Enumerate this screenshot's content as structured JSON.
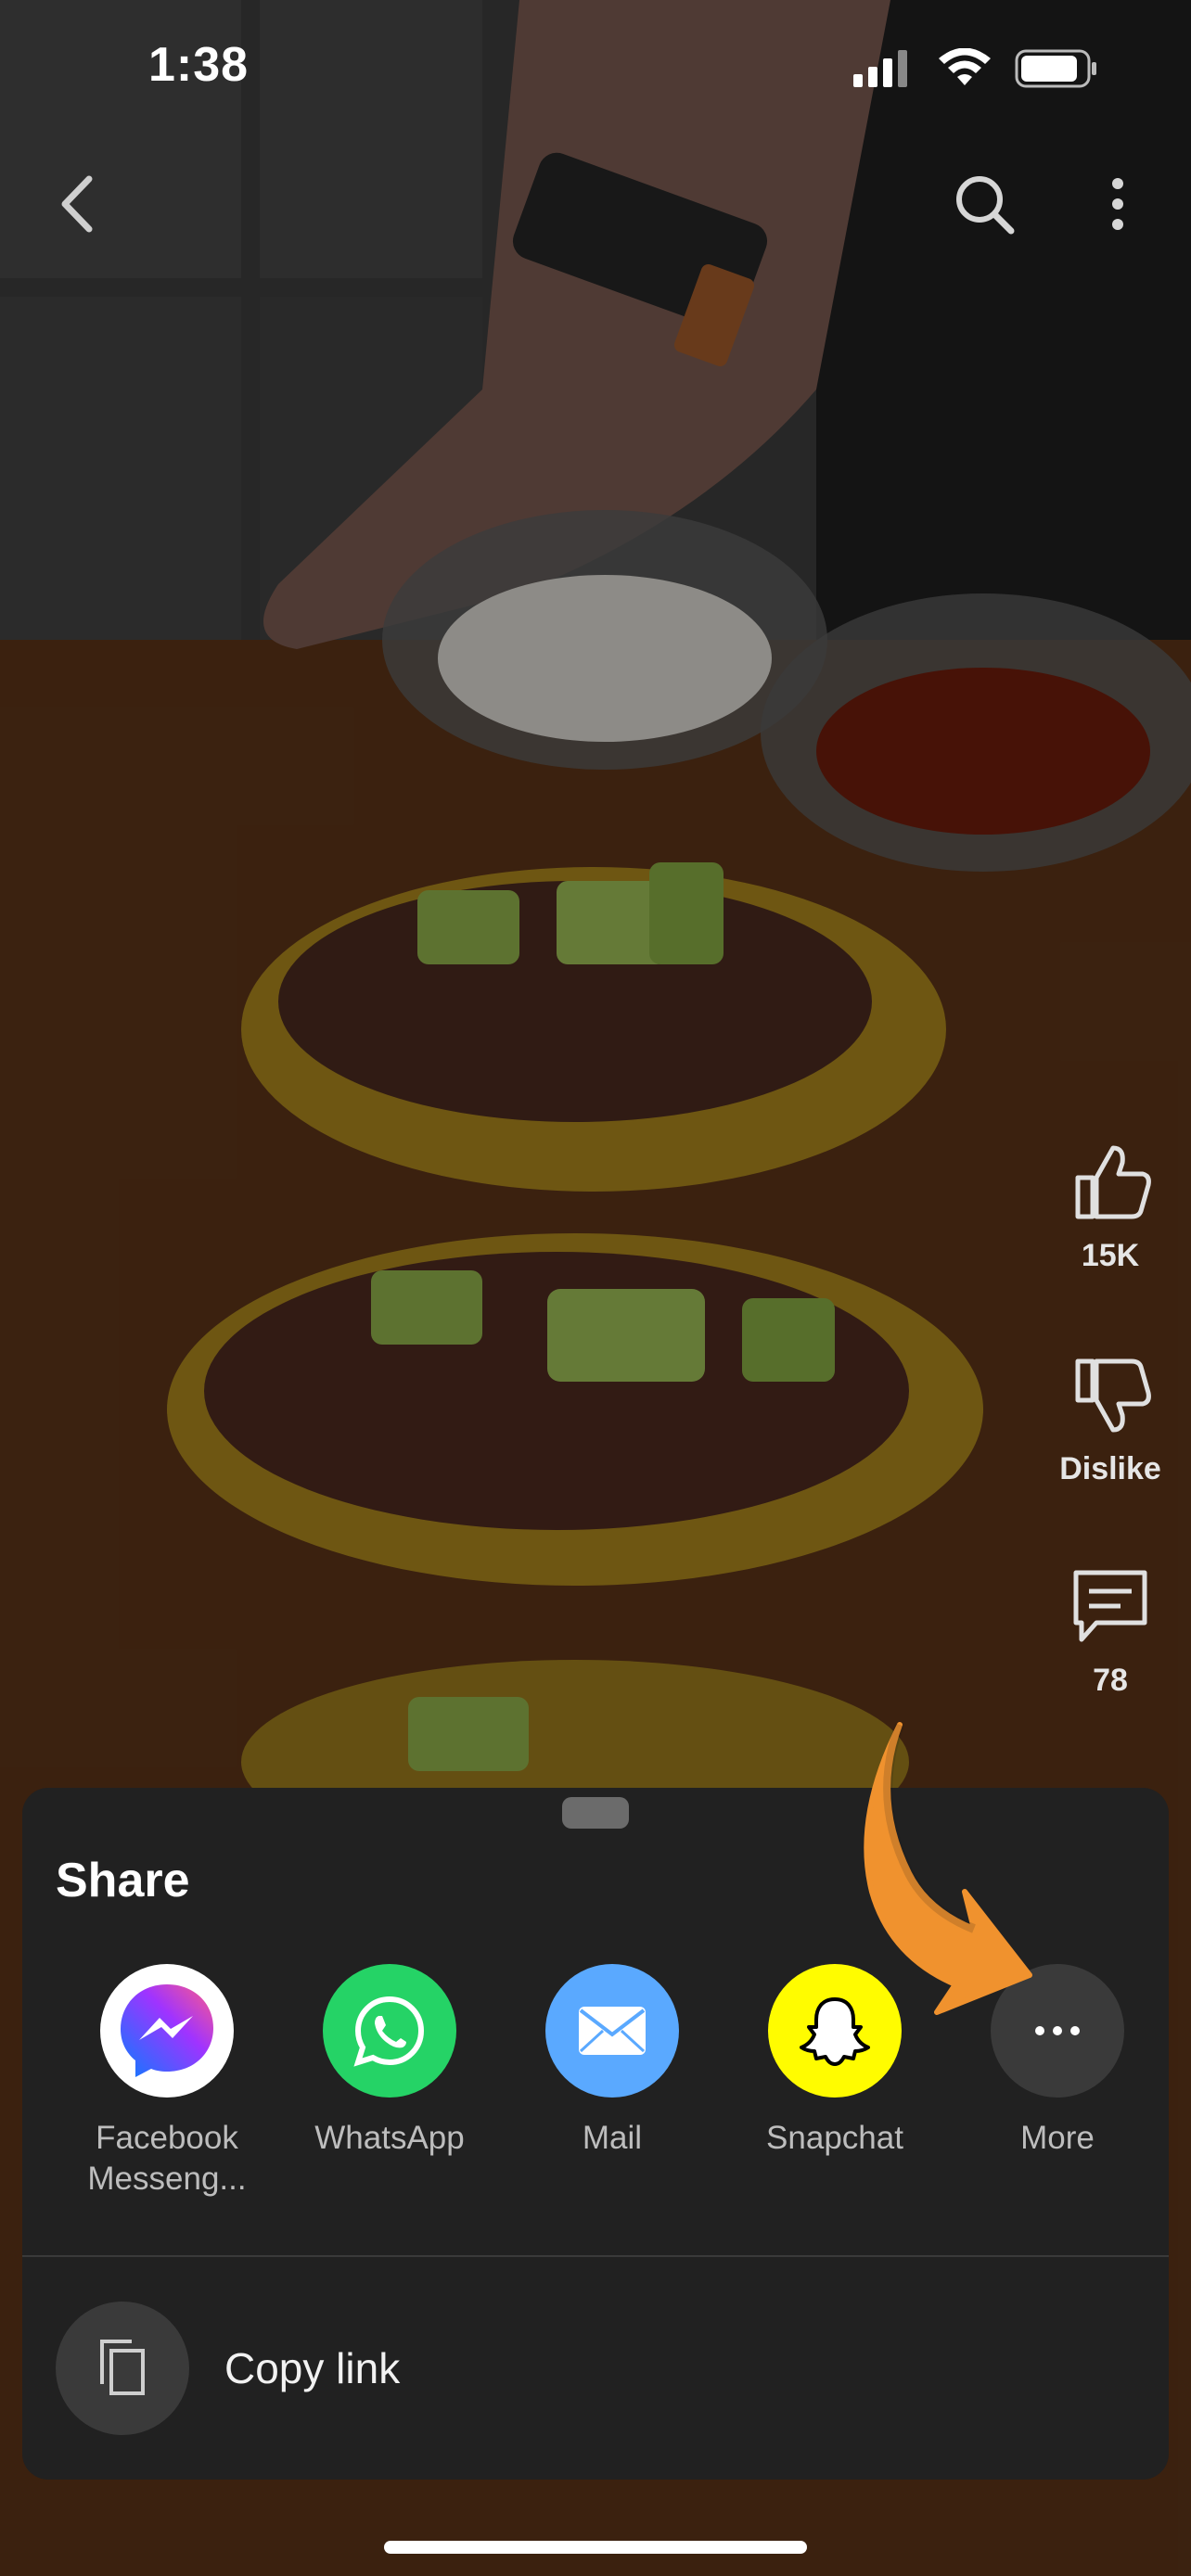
{
  "status_bar": {
    "time": "1:38"
  },
  "actions": {
    "like_count": "15K",
    "dislike_label": "Dislike",
    "comment_count": "78"
  },
  "share_sheet": {
    "title": "Share",
    "apps": [
      {
        "label": "Facebook Messeng...",
        "icon": "messenger-icon",
        "bg": "#ffffff"
      },
      {
        "label": "WhatsApp",
        "icon": "whatsapp-icon",
        "bg": "#25d366"
      },
      {
        "label": "Mail",
        "icon": "mail-icon",
        "bg": "#5aa9ff"
      },
      {
        "label": "Snapchat",
        "icon": "snapchat-icon",
        "bg": "#fffc00"
      },
      {
        "label": "More",
        "icon": "more-icon",
        "bg": "#3a3a3a"
      }
    ],
    "copy_link_label": "Copy link"
  },
  "colors": {
    "sheet_bg": "#212121",
    "annotation_arrow": "#f0922e"
  }
}
